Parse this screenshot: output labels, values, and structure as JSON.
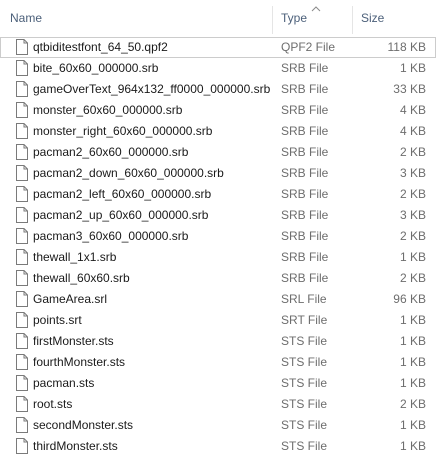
{
  "header": {
    "name_label": "Name",
    "type_label": "Type",
    "size_label": "Size",
    "sorted_column": "Type",
    "sort_icon": "sort-up-caret-icon"
  },
  "file_icon": "generic-file-icon",
  "selected_index": 0,
  "files": [
    {
      "name": "qtbiditestfont_64_50.qpf2",
      "type": "QPF2 File",
      "size": "118 KB"
    },
    {
      "name": "bite_60x60_000000.srb",
      "type": "SRB File",
      "size": "1 KB"
    },
    {
      "name": "gameOverText_964x132_ff0000_000000.srb",
      "type": "SRB File",
      "size": "33 KB"
    },
    {
      "name": "monster_60x60_000000.srb",
      "type": "SRB File",
      "size": "4 KB"
    },
    {
      "name": "monster_right_60x60_000000.srb",
      "type": "SRB File",
      "size": "4 KB"
    },
    {
      "name": "pacman2_60x60_000000.srb",
      "type": "SRB File",
      "size": "2 KB"
    },
    {
      "name": "pacman2_down_60x60_000000.srb",
      "type": "SRB File",
      "size": "3 KB"
    },
    {
      "name": "pacman2_left_60x60_000000.srb",
      "type": "SRB File",
      "size": "2 KB"
    },
    {
      "name": "pacman2_up_60x60_000000.srb",
      "type": "SRB File",
      "size": "3 KB"
    },
    {
      "name": "pacman3_60x60_000000.srb",
      "type": "SRB File",
      "size": "2 KB"
    },
    {
      "name": "thewall_1x1.srb",
      "type": "SRB File",
      "size": "1 KB"
    },
    {
      "name": "thewall_60x60.srb",
      "type": "SRB File",
      "size": "2 KB"
    },
    {
      "name": "GameArea.srl",
      "type": "SRL File",
      "size": "96 KB"
    },
    {
      "name": "points.srt",
      "type": "SRT File",
      "size": "1 KB"
    },
    {
      "name": "firstMonster.sts",
      "type": "STS File",
      "size": "1 KB"
    },
    {
      "name": "fourthMonster.sts",
      "type": "STS File",
      "size": "1 KB"
    },
    {
      "name": "pacman.sts",
      "type": "STS File",
      "size": "1 KB"
    },
    {
      "name": "root.sts",
      "type": "STS File",
      "size": "2 KB"
    },
    {
      "name": "secondMonster.sts",
      "type": "STS File",
      "size": "1 KB"
    },
    {
      "name": "thirdMonster.sts",
      "type": "STS File",
      "size": "1 KB"
    }
  ],
  "colors": {
    "header_text": "#4c607a",
    "name_text": "#1a1a1a",
    "detail_text": "#6d6d6d",
    "selection_border": "#cccccc",
    "column_separator": "#e5e5e5"
  }
}
